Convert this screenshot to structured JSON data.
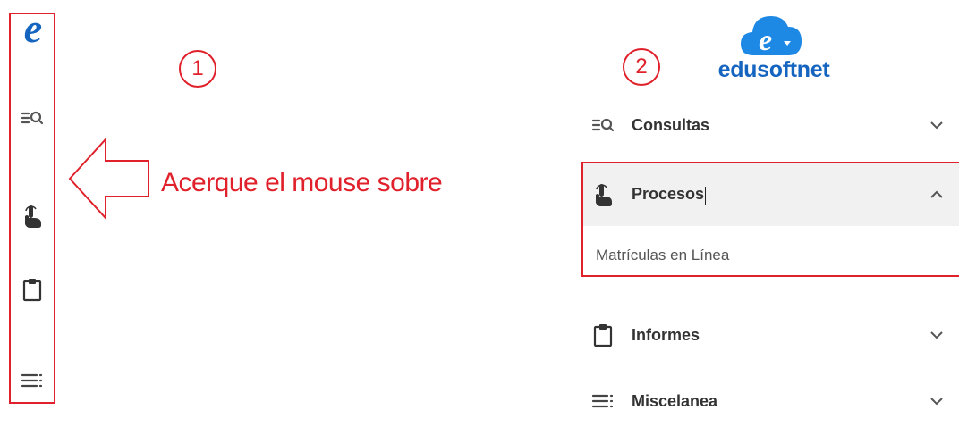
{
  "callouts": {
    "step1": "1",
    "step2": "2",
    "instruction": "Acerque el mouse sobre"
  },
  "sidebar_collapsed": {
    "logo_letter": "e",
    "icons": [
      "search-list-icon",
      "hand-pointer-icon",
      "clipboard-icon",
      "list-menu-icon"
    ]
  },
  "brand": {
    "name": "edusoftnet",
    "logo_icon": "cloud-e-logo"
  },
  "menu": {
    "items": [
      {
        "label": "Consultas",
        "icon": "search-list-icon",
        "state": "collapsed"
      },
      {
        "label": "Procesos",
        "icon": "hand-pointer-icon",
        "state": "expanded",
        "children": [
          {
            "label": "Matrículas en Línea"
          }
        ]
      },
      {
        "label": "Informes",
        "icon": "clipboard-icon",
        "state": "collapsed"
      },
      {
        "label": "Miscelanea",
        "icon": "list-menu-icon",
        "state": "collapsed"
      }
    ]
  },
  "colors": {
    "brand_blue": "#1565c0",
    "annotation_red": "#e0202a",
    "icon_gray": "#555555"
  }
}
